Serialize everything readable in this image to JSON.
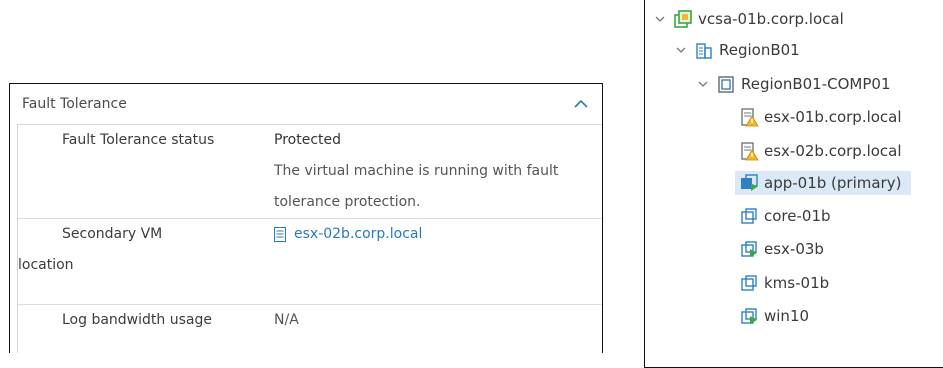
{
  "fault_tolerance": {
    "section_title": "Fault Tolerance",
    "rows": [
      {
        "label": "Fault Tolerance status",
        "value": "Protected",
        "description_line1": "The virtual machine is running with fault",
        "description_line2": "tolerance protection."
      },
      {
        "label_line1": "Secondary VM",
        "label_line2": "location",
        "value": "esx-02b.corp.local"
      },
      {
        "label": "Log bandwidth usage",
        "value": "N/A"
      }
    ]
  },
  "inventory_tree": {
    "vcenter": "vcsa-01b.corp.local",
    "datacenter": "RegionB01",
    "cluster": "RegionB01-COMP01",
    "hosts": [
      "esx-01b.corp.local",
      "esx-02b.corp.local"
    ],
    "vms": [
      "app-01b (primary)",
      "core-01b",
      "esx-03b",
      "kms-01b",
      "win10"
    ],
    "selected_vm": "app-01b (primary)"
  },
  "colors": {
    "link": "#2a79b8",
    "selection": "#dbe9f6",
    "warning": "#f2b632",
    "vm_green": "#3aa83a",
    "vm_blue": "#2f7fc6"
  }
}
